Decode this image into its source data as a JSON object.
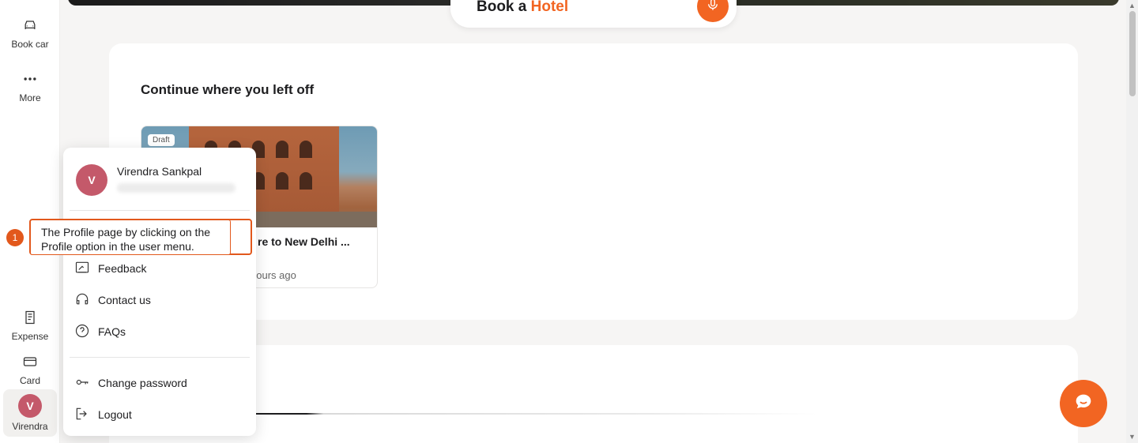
{
  "sidebar": {
    "items": [
      {
        "label": "Book car",
        "icon": "car-icon"
      },
      {
        "label": "More",
        "icon": "more-icon"
      },
      {
        "label": "Expense",
        "icon": "receipt-icon"
      },
      {
        "label": "Card",
        "icon": "card-icon"
      },
      {
        "label": "Virendra",
        "icon": "avatar"
      }
    ],
    "avatar_initial": "V"
  },
  "header": {
    "book_prefix": "Book a",
    "book_accent": "Hotel",
    "accent_color": "#f26522"
  },
  "continue_section": {
    "title": "Continue where you left off",
    "trip": {
      "badge": "Draft",
      "title": "re to New Delhi ...",
      "time": "hours ago"
    }
  },
  "user_menu": {
    "name": "Virendra Sankpal",
    "initial": "V",
    "items": [
      {
        "label": "Feedback",
        "icon": "feedback-icon"
      },
      {
        "label": "Contact us",
        "icon": "headset-icon"
      },
      {
        "label": "FAQs",
        "icon": "help-icon"
      },
      {
        "label": "Change password",
        "icon": "key-icon"
      },
      {
        "label": "Logout",
        "icon": "logout-icon"
      }
    ]
  },
  "annotation": {
    "number": "1",
    "text": "The Profile page by clicking on the Profile option in the user menu."
  },
  "colors": {
    "avatar": "#c4596a",
    "annotation": "#e2581c"
  }
}
